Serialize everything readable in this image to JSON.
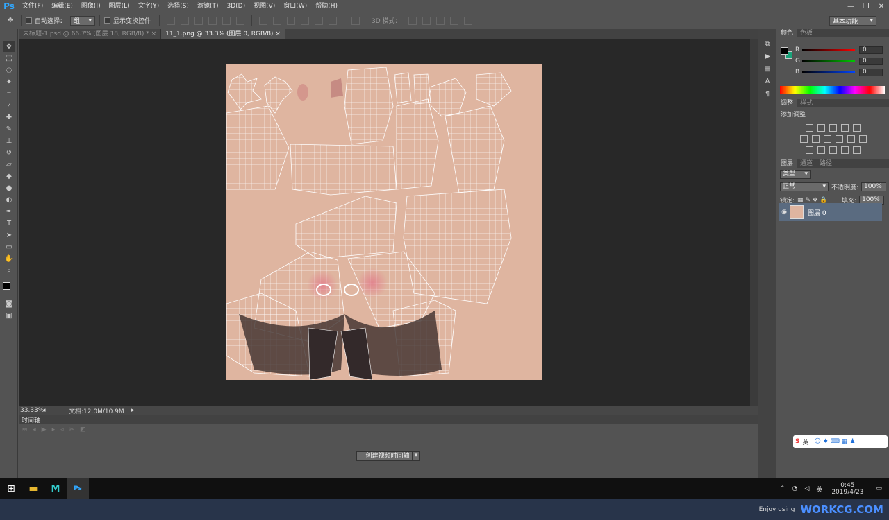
{
  "app": {
    "logo": "Ps"
  },
  "menu": [
    "文件(F)",
    "编辑(E)",
    "图像(I)",
    "图层(L)",
    "文字(Y)",
    "选择(S)",
    "滤镜(T)",
    "3D(D)",
    "视图(V)",
    "窗口(W)",
    "帮助(H)"
  ],
  "options": {
    "auto_select_label": "自动选择：",
    "auto_select_value": "组",
    "show_transform_label": "显示变换控件",
    "mode_3d_label": "3D 模式：",
    "workspace": "基本功能"
  },
  "tabs": [
    {
      "label": "未标题-1.psd @ 66.7% (图层 18, RGB/8) *",
      "active": false
    },
    {
      "label": "11_1.png @ 33.3% (图层 0, RGB/8)",
      "active": true
    }
  ],
  "status": {
    "zoom": "33.33%",
    "doc_info": "文档:12.0M/10.9M"
  },
  "timeline": {
    "title": "时间轴",
    "create_button": "创建视频时间轴"
  },
  "color_panel": {
    "tabs": [
      "颜色",
      "色板"
    ],
    "channels": [
      {
        "label": "R",
        "value": "0",
        "color": "#ff0000"
      },
      {
        "label": "G",
        "value": "0",
        "color": "#00c800"
      },
      {
        "label": "B",
        "value": "0",
        "color": "#0044ff"
      }
    ]
  },
  "adjust_panel": {
    "tabs": [
      "调整",
      "样式"
    ],
    "title": "添加调整"
  },
  "layers_panel": {
    "tabs": [
      "图层",
      "通道",
      "路径"
    ],
    "filter": "类型",
    "blend": "正常",
    "opacity_label": "不透明度:",
    "opacity": "100%",
    "lock_label": "锁定:",
    "fill_label": "填充:",
    "fill": "100%",
    "layer_name": "图层 0"
  },
  "ime": {
    "label": "英"
  },
  "tray": {
    "lang": "英",
    "time": "0:45",
    "date": "2019/4/23"
  },
  "footer": {
    "enjoy": "Enjoy using",
    "brand": "WORKCG.COM"
  },
  "colors": {
    "foreground": "#000000",
    "background": "#1aa37a",
    "canvas": "#dfb5a0",
    "ps_blue": "#31a8ff"
  }
}
